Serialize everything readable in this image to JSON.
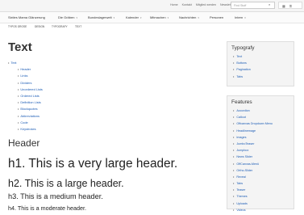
{
  "topbar": {
    "links": [
      "Home",
      "Kontakt",
      "Mitglied werden",
      "Newsletter"
    ],
    "search_placeholder": "Find Stuff"
  },
  "mainnav": {
    "items": [
      {
        "label": "Sixties Mama Glänzerung",
        "dropdown": false
      },
      {
        "label": "Die Gräben",
        "dropdown": true
      },
      {
        "label": "Bundeslagerwelt",
        "dropdown": true
      },
      {
        "label": "Kalender",
        "dropdown": true
      },
      {
        "label": "Mitmachen",
        "dropdown": true
      },
      {
        "label": "Nachrichten",
        "dropdown": true
      },
      {
        "label": "Personen",
        "dropdown": false
      },
      {
        "label": "Intern",
        "dropdown": true
      }
    ]
  },
  "subnav": {
    "items": [
      "TYPOS GROSE",
      "DESIGN",
      "TYPOGRAFY",
      "TEXT"
    ]
  },
  "content": {
    "title": "Text",
    "tree": [
      {
        "label": "Text",
        "indent": 0
      },
      {
        "label": "Header",
        "indent": 1
      },
      {
        "label": "Links",
        "indent": 1
      },
      {
        "label": "Dividers",
        "indent": 1
      },
      {
        "label": "Unordered Lists",
        "indent": 1
      },
      {
        "label": "Ordered Lists",
        "indent": 1
      },
      {
        "label": "Definition Lists",
        "indent": 1
      },
      {
        "label": "Blockquotes",
        "indent": 1
      },
      {
        "label": "Abbreviations",
        "indent": 1
      },
      {
        "label": "Code",
        "indent": 1
      },
      {
        "label": "Keystrokes",
        "indent": 1
      }
    ],
    "header_title": "Header",
    "h1": "h1. This is a very large header.",
    "h2": "h2. This is a large header.",
    "h3": "h3. This is a medium header.",
    "h4": "h4. This is a moderate header."
  },
  "sidebar": {
    "typografy": {
      "title": "Typografy",
      "items": [
        "Text",
        "Buttons",
        "Pagination",
        "Tabs"
      ]
    },
    "features": {
      "title": "Features",
      "items": [
        "Accordion",
        "Callout",
        "Offcanvas Dropdown Menu",
        "Headlinemage",
        "Images",
        "JumboTeaser",
        "Jumpbox",
        "News Slider",
        "OffCanvas-Menü",
        "Ortho-Slider",
        "Reveal",
        "Tabs",
        "Teaser",
        "Themes",
        "Uploads",
        "Videos"
      ]
    }
  },
  "colors": {
    "link": "#1a5bb5",
    "text": "#333333",
    "box_bg": "#f4f4f4"
  }
}
